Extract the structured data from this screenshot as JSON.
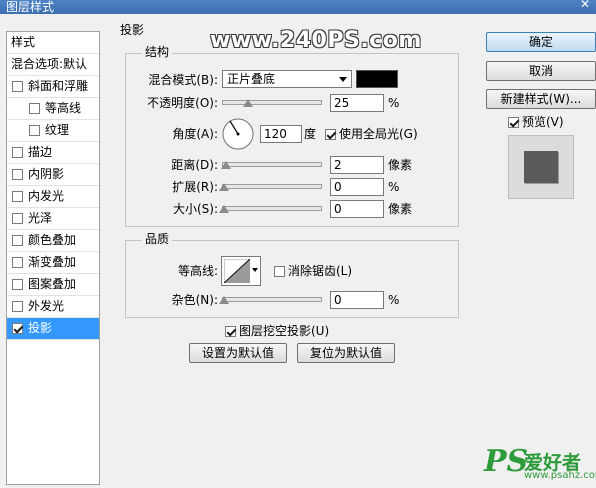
{
  "window": {
    "title": "图层样式",
    "close_glyph": "✕"
  },
  "styles_panel": {
    "header": "样式",
    "blend_options": "混合选项:默认",
    "items": [
      {
        "label": "斜面和浮雕",
        "checked": false,
        "indent": false
      },
      {
        "label": "等高线",
        "checked": false,
        "indent": true
      },
      {
        "label": "纹理",
        "checked": false,
        "indent": true
      },
      {
        "label": "描边",
        "checked": false,
        "indent": false
      },
      {
        "label": "内阴影",
        "checked": false,
        "indent": false
      },
      {
        "label": "内发光",
        "checked": false,
        "indent": false
      },
      {
        "label": "光泽",
        "checked": false,
        "indent": false
      },
      {
        "label": "颜色叠加",
        "checked": false,
        "indent": false
      },
      {
        "label": "渐变叠加",
        "checked": false,
        "indent": false
      },
      {
        "label": "图案叠加",
        "checked": false,
        "indent": false
      },
      {
        "label": "外发光",
        "checked": false,
        "indent": false
      },
      {
        "label": "投影",
        "checked": true,
        "indent": false,
        "selected": true
      }
    ]
  },
  "drop_shadow": {
    "title": "投影",
    "structure": {
      "legend": "结构",
      "blend_mode_label": "混合模式(B):",
      "blend_mode_value": "正片叠底",
      "shadow_color": "#000000",
      "opacity_label": "不透明度(O):",
      "opacity_value": "25",
      "opacity_unit": "%",
      "angle_label": "角度(A):",
      "angle_value": "120",
      "angle_unit": "度",
      "global_light_label": "使用全局光(G)",
      "global_light_checked": true,
      "distance_label": "距离(D):",
      "distance_value": "2",
      "distance_unit": "像素",
      "spread_label": "扩展(R):",
      "spread_value": "0",
      "spread_unit": "%",
      "size_label": "大小(S):",
      "size_value": "0",
      "size_unit": "像素"
    },
    "quality": {
      "legend": "品质",
      "contour_label": "等高线:",
      "anti_alias_label": "消除锯齿(L)",
      "anti_alias_checked": false,
      "noise_label": "杂色(N):",
      "noise_value": "0",
      "noise_unit": "%"
    },
    "knockout_label": "图层挖空投影(U)",
    "knockout_checked": true,
    "set_default_label": "设置为默认值",
    "reset_default_label": "复位为默认值"
  },
  "buttons": {
    "ok": "确定",
    "cancel": "取消",
    "new_style": "新建样式(W)...",
    "preview_label": "预览(V)",
    "preview_checked": true
  },
  "watermark": {
    "text": "www.240PS.com",
    "logo_ps": "PS",
    "logo_name": "爱好者",
    "logo_url": "www.psahz.com"
  }
}
